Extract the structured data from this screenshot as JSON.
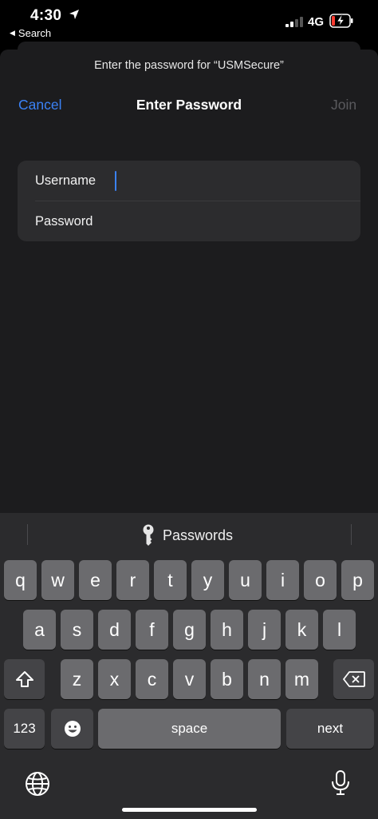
{
  "status_bar": {
    "time": "4:30",
    "back_app_label": "Search",
    "network": "4G",
    "location_icon": "location-arrow-icon",
    "battery_icon": "battery-charging-icon"
  },
  "dialog": {
    "prompt": "Enter the password for “USMSecure”",
    "cancel_label": "Cancel",
    "title": "Enter Password",
    "join_label": "Join",
    "username_label": "Username",
    "password_label": "Password"
  },
  "keyboard": {
    "suggestion": "Passwords",
    "row1": [
      "q",
      "w",
      "e",
      "r",
      "t",
      "y",
      "u",
      "i",
      "o",
      "p"
    ],
    "row2": [
      "a",
      "s",
      "d",
      "f",
      "g",
      "h",
      "j",
      "k",
      "l"
    ],
    "row3": [
      "z",
      "x",
      "c",
      "v",
      "b",
      "n",
      "m"
    ],
    "numbers_label": "123",
    "space_label": "space",
    "next_label": "next",
    "accent_color": "#3b82f6"
  }
}
